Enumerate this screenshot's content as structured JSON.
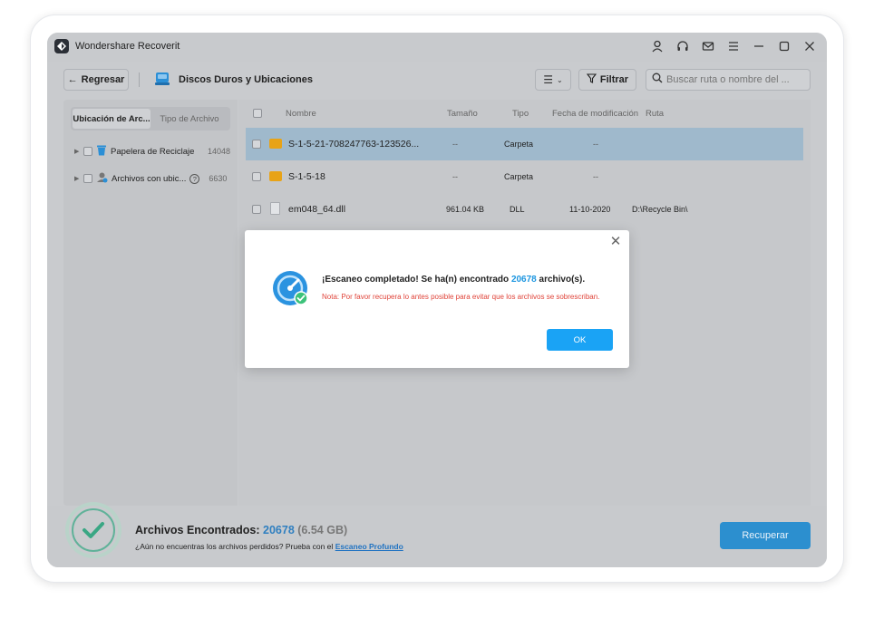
{
  "app": {
    "title": "Wondershare Recoverit"
  },
  "toolbar": {
    "back_label": "Regresar",
    "location_title": "Discos Duros y Ubicaciones",
    "filter_label": "Filtrar",
    "search_placeholder": "Buscar ruta o nombre del ..."
  },
  "sidebar": {
    "tabs": [
      {
        "label": "Ubicación de Arc...",
        "active": true
      },
      {
        "label": "Tipo de Archivo",
        "active": false
      }
    ],
    "items": [
      {
        "label": "Papelera de Reciclaje",
        "count": "14048"
      },
      {
        "label": "Archivos con ubic...",
        "count": "6630"
      }
    ]
  },
  "list": {
    "headers": {
      "name": "Nombre",
      "size": "Tamaño",
      "type": "Tipo",
      "date": "Fecha de modificación",
      "path": "Ruta"
    },
    "rows": [
      {
        "name": "S-1-5-21-708247763-123526...",
        "size": "--",
        "type": "Carpeta",
        "date": "--",
        "path": "",
        "kind": "folder",
        "selected": true
      },
      {
        "name": "S-1-5-18",
        "size": "--",
        "type": "Carpeta",
        "date": "--",
        "path": "",
        "kind": "folder",
        "selected": false
      },
      {
        "name": "em048_64.dll",
        "size": "961.04 KB",
        "type": "DLL",
        "date": "11-10-2020",
        "path": "D:\\Recycle Bin\\",
        "kind": "file",
        "selected": false
      }
    ]
  },
  "footer": {
    "found_label": "Archivos Encontrados:",
    "found_count": "20678",
    "found_size": "(6.54 GB)",
    "hint_text": "¿Aún no encuentras los archivos perdidos? Prueba con el",
    "deep_scan_link": "Escaneo Profundo",
    "recover_label": "Recuperar"
  },
  "dialog": {
    "title_prefix": "¡Escaneo completado! Se ha(n) encontrado",
    "count": "20678",
    "title_suffix": "archivo(s).",
    "note": "Nota: Por favor recupera lo antes posible para evitar que los archivos se sobrescriban.",
    "ok_label": "OK"
  },
  "colors": {
    "accent": "#1aa3f5",
    "note_red": "#e0443a",
    "success_green": "#60b299",
    "folder": "#e8a317"
  }
}
